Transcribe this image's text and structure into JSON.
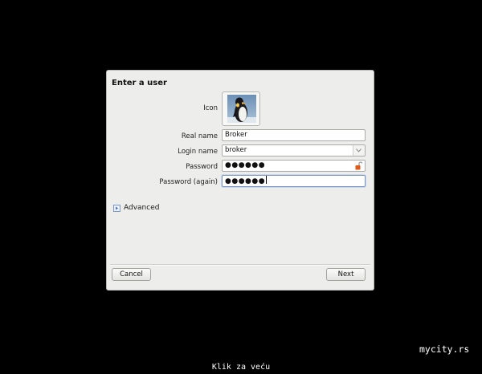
{
  "dialog": {
    "title": "Enter a user",
    "labels": {
      "icon": "Icon",
      "real_name": "Real name",
      "login_name": "Login name",
      "password": "Password",
      "password_again": "Password (again)"
    },
    "fields": {
      "real_name": "Broker",
      "login_name": "broker",
      "password": "●●●●●●",
      "password_again": "●●●●●●"
    },
    "icons": {
      "avatar": "penguin-icon",
      "combo": "chevron-down-icon",
      "lock": "unlocked-padlock-icon",
      "expander": "expander-arrow-icon"
    },
    "advanced_label": "Advanced",
    "buttons": {
      "cancel": "Cancel",
      "next": "Next"
    }
  },
  "watermark": "mycity.rs",
  "footer_text": "Klik za veću",
  "colors": {
    "background": "#000000",
    "dialog_bg": "#ededeb",
    "focus_border": "#7d97c1",
    "lock_color": "#e05a1a"
  }
}
